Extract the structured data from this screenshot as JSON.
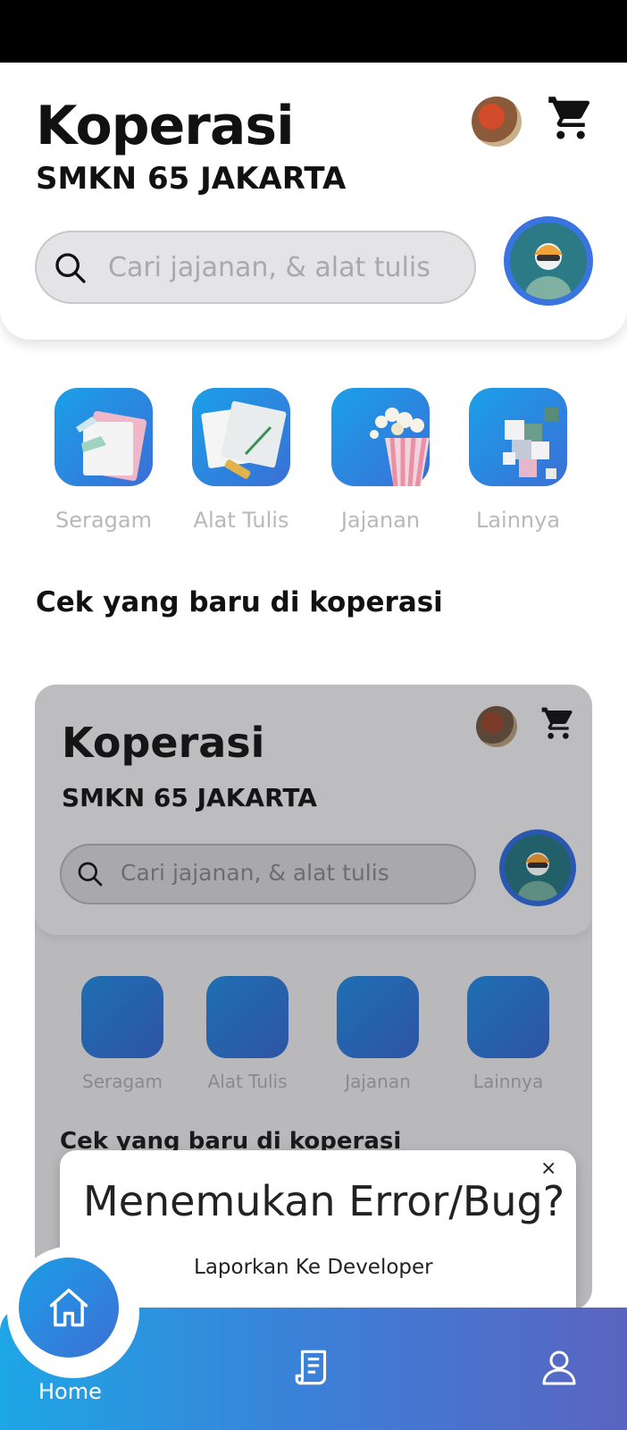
{
  "header": {
    "title": "Koperasi",
    "subtitle": "SMKN 65 JAKARTA",
    "search_placeholder": "Cari jajanan, & alat tulis"
  },
  "categories": [
    {
      "label": "Seragam",
      "icon": "uniform-icon"
    },
    {
      "label": "Alat Tulis",
      "icon": "stationery-icon"
    },
    {
      "label": "Jajanan",
      "icon": "popcorn-icon"
    },
    {
      "label": "Lainnya",
      "icon": "blocks-icon"
    }
  ],
  "section_title": "Cek yang baru di koperasi",
  "preview": {
    "title": "Koperasi",
    "subtitle": "SMKN 65 JAKARTA",
    "search_text": "Cari jajanan, & alat tulis",
    "categories": [
      "Seragam",
      "Alat Tulis",
      "Jajanan",
      "Lainnya"
    ],
    "section_title": "Cek yang baru di koperasi"
  },
  "bug_card": {
    "close_label": "×",
    "title": "Menemukan Error/Bug?",
    "subtitle": "Laporkan Ke Developer"
  },
  "bottom_nav": {
    "home_label": "Home",
    "items": [
      "home-icon",
      "receipt-icon",
      "user-icon"
    ]
  },
  "colors": {
    "accent": "#3b6fd6",
    "accent_light": "#1ea6e6",
    "label_gray": "#b9b9bd"
  }
}
